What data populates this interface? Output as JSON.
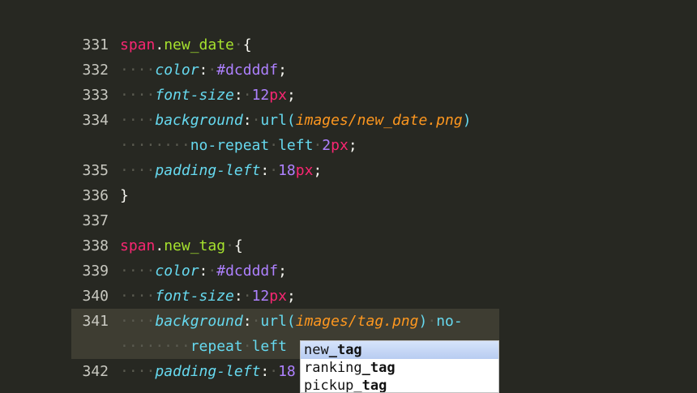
{
  "editor": {
    "lines": [
      {
        "num": "331",
        "parts": [
          [
            "tag",
            "span"
          ],
          [
            "punc",
            "."
          ],
          [
            "sel",
            "new_date"
          ],
          [
            "ws",
            "·"
          ],
          [
            "punc",
            "{"
          ]
        ]
      },
      {
        "num": "332",
        "parts": [
          [
            "ws",
            "····"
          ],
          [
            "prop",
            "color"
          ],
          [
            "punc",
            ":"
          ],
          [
            "ws",
            "·"
          ],
          [
            "color",
            "#dcdddf"
          ],
          [
            "punc",
            ";"
          ]
        ]
      },
      {
        "num": "333",
        "parts": [
          [
            "ws",
            "····"
          ],
          [
            "prop",
            "font-size"
          ],
          [
            "punc",
            ":"
          ],
          [
            "ws",
            "·"
          ],
          [
            "num",
            "12"
          ],
          [
            "unit",
            "px"
          ],
          [
            "punc",
            ";"
          ]
        ]
      },
      {
        "num": "334",
        "parts": [
          [
            "ws",
            "····"
          ],
          [
            "prop",
            "background"
          ],
          [
            "punc",
            ":"
          ],
          [
            "ws",
            "·"
          ],
          [
            "func",
            "url("
          ],
          [
            "str",
            "images/new_date.png"
          ],
          [
            "func",
            ")"
          ]
        ]
      },
      {
        "num": "",
        "parts": [
          [
            "ws",
            "········"
          ],
          [
            "val",
            "no-repeat"
          ],
          [
            "ws",
            "·"
          ],
          [
            "val",
            "left"
          ],
          [
            "ws",
            "·"
          ],
          [
            "num",
            "2"
          ],
          [
            "unit",
            "px"
          ],
          [
            "punc",
            ";"
          ]
        ]
      },
      {
        "num": "335",
        "parts": [
          [
            "ws",
            "····"
          ],
          [
            "prop",
            "padding-left"
          ],
          [
            "punc",
            ":"
          ],
          [
            "ws",
            "·"
          ],
          [
            "num",
            "18"
          ],
          [
            "unit",
            "px"
          ],
          [
            "punc",
            ";"
          ]
        ]
      },
      {
        "num": "336",
        "parts": [
          [
            "punc",
            "}"
          ]
        ]
      },
      {
        "num": "337",
        "parts": []
      },
      {
        "num": "338",
        "parts": [
          [
            "tag",
            "span"
          ],
          [
            "punc",
            "."
          ],
          [
            "sel",
            "new_tag"
          ],
          [
            "ws",
            "·"
          ],
          [
            "punc",
            "{"
          ]
        ]
      },
      {
        "num": "339",
        "parts": [
          [
            "ws",
            "····"
          ],
          [
            "prop",
            "color"
          ],
          [
            "punc",
            ":"
          ],
          [
            "ws",
            "·"
          ],
          [
            "color",
            "#dcdddf"
          ],
          [
            "punc",
            ";"
          ]
        ]
      },
      {
        "num": "340",
        "parts": [
          [
            "ws",
            "····"
          ],
          [
            "prop",
            "font-size"
          ],
          [
            "punc",
            ":"
          ],
          [
            "ws",
            "·"
          ],
          [
            "num",
            "12"
          ],
          [
            "unit",
            "px"
          ],
          [
            "punc",
            ";"
          ]
        ]
      },
      {
        "num": "341",
        "current": true,
        "parts": [
          [
            "ws",
            "····"
          ],
          [
            "prop",
            "background"
          ],
          [
            "punc",
            ":"
          ],
          [
            "ws",
            "·"
          ],
          [
            "func",
            "url("
          ],
          [
            "str",
            "images/tag.png"
          ],
          [
            "func",
            ")"
          ],
          [
            "ws",
            "·"
          ],
          [
            "val",
            "no-"
          ]
        ]
      },
      {
        "num": "",
        "current": true,
        "parts": [
          [
            "ws",
            "········"
          ],
          [
            "val",
            "repeat"
          ],
          [
            "ws",
            "·"
          ],
          [
            "val",
            "left"
          ]
        ]
      },
      {
        "num": "342",
        "parts": [
          [
            "ws",
            "····"
          ],
          [
            "prop",
            "padding-left"
          ],
          [
            "punc",
            ":"
          ],
          [
            "ws",
            "·"
          ],
          [
            "num",
            "18"
          ]
        ]
      }
    ]
  },
  "autocomplete": {
    "items": [
      {
        "prefix": "new",
        "match": "_tag",
        "selected": true
      },
      {
        "prefix": "ranking",
        "match": "_tag",
        "selected": false
      },
      {
        "prefix": "pickup",
        "match": "_tag",
        "selected": false
      }
    ]
  }
}
